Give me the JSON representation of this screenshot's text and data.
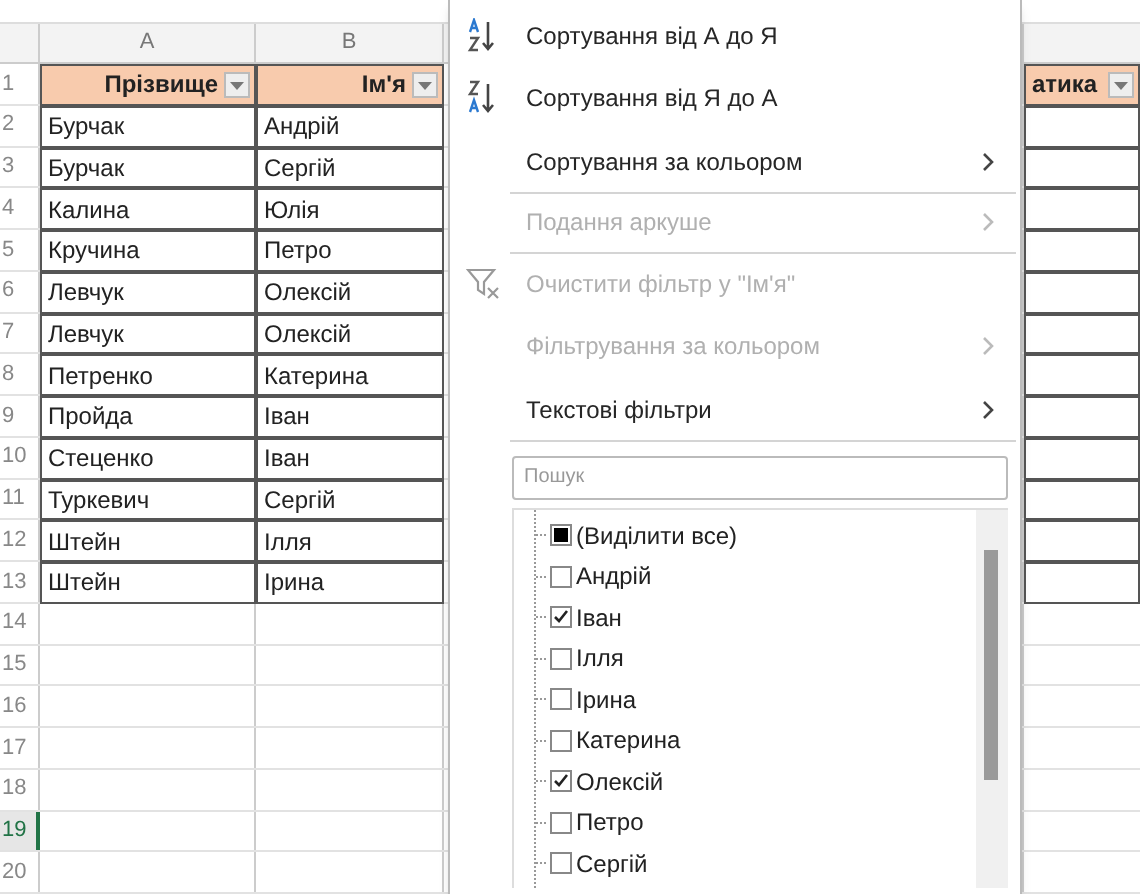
{
  "sheet": {
    "column_headers": [
      "A",
      "B"
    ],
    "header_row": [
      "Прізвище",
      "Ім'я",
      "атика"
    ],
    "rows": [
      [
        "Бурчак",
        "Андрій"
      ],
      [
        "Бурчак",
        "Сергій"
      ],
      [
        "Калина",
        "Юлія"
      ],
      [
        "Кручина",
        "Петро"
      ],
      [
        "Левчук",
        "Олексій"
      ],
      [
        "Левчук",
        "Олексій"
      ],
      [
        "Петренко",
        "Катерина"
      ],
      [
        "Пройда",
        "Іван"
      ],
      [
        "Стеценко",
        "Іван"
      ],
      [
        "Туркевич",
        "Сергій"
      ],
      [
        "Штейн",
        "Ілля"
      ],
      [
        "Штейн",
        "Ірина"
      ]
    ],
    "row_numbers": [
      {
        "label": "1",
        "selected": false
      },
      {
        "label": "2",
        "selected": false
      },
      {
        "label": "3",
        "selected": false
      },
      {
        "label": "4",
        "selected": false
      },
      {
        "label": "5",
        "selected": false
      },
      {
        "label": "6",
        "selected": false
      },
      {
        "label": "7",
        "selected": false
      },
      {
        "label": "8",
        "selected": false
      },
      {
        "label": "9",
        "selected": false
      },
      {
        "label": "10",
        "selected": false
      },
      {
        "label": "11",
        "selected": false
      },
      {
        "label": "12",
        "selected": false
      },
      {
        "label": "13",
        "selected": false
      },
      {
        "label": "14",
        "selected": false
      },
      {
        "label": "15",
        "selected": false
      },
      {
        "label": "16",
        "selected": false
      },
      {
        "label": "17",
        "selected": false
      },
      {
        "label": "18",
        "selected": false
      },
      {
        "label": "19",
        "selected": true
      },
      {
        "label": "20",
        "selected": false
      }
    ]
  },
  "filter_menu": {
    "items": [
      {
        "label": "Сортування від А до Я",
        "kind": "sort_asc",
        "disabled": false,
        "submenu": false,
        "separator_after": false
      },
      {
        "label": "Сортування від Я до А",
        "kind": "sort_desc",
        "disabled": false,
        "submenu": false,
        "separator_after": false
      },
      {
        "label": "Сортування за кольором",
        "kind": "plain",
        "disabled": false,
        "submenu": true,
        "separator_after": true
      },
      {
        "label": "Подання аркуше",
        "kind": "plain",
        "disabled": true,
        "submenu": true,
        "separator_after": true
      },
      {
        "label": "Очистити фільтр у \"Ім'я\"",
        "kind": "clear_filter",
        "disabled": true,
        "submenu": false,
        "separator_after": false
      },
      {
        "label": "Фільтрування за кольором",
        "kind": "plain",
        "disabled": true,
        "submenu": true,
        "separator_after": false
      },
      {
        "label": "Текстові фільтри",
        "kind": "plain",
        "disabled": false,
        "submenu": true,
        "separator_after": true
      }
    ],
    "search": {
      "placeholder": "Пошук"
    },
    "values": [
      {
        "label": "(Виділити все)",
        "checked": false,
        "indeterminate": true
      },
      {
        "label": "Андрій",
        "checked": false,
        "indeterminate": false
      },
      {
        "label": "Іван",
        "checked": true,
        "indeterminate": false
      },
      {
        "label": "Ілля",
        "checked": false,
        "indeterminate": false
      },
      {
        "label": "Ірина",
        "checked": false,
        "indeterminate": false
      },
      {
        "label": "Катерина",
        "checked": false,
        "indeterminate": false
      },
      {
        "label": "Олексій",
        "checked": true,
        "indeterminate": false
      },
      {
        "label": "Петро",
        "checked": false,
        "indeterminate": false
      },
      {
        "label": "Сергій",
        "checked": false,
        "indeterminate": false
      }
    ]
  }
}
